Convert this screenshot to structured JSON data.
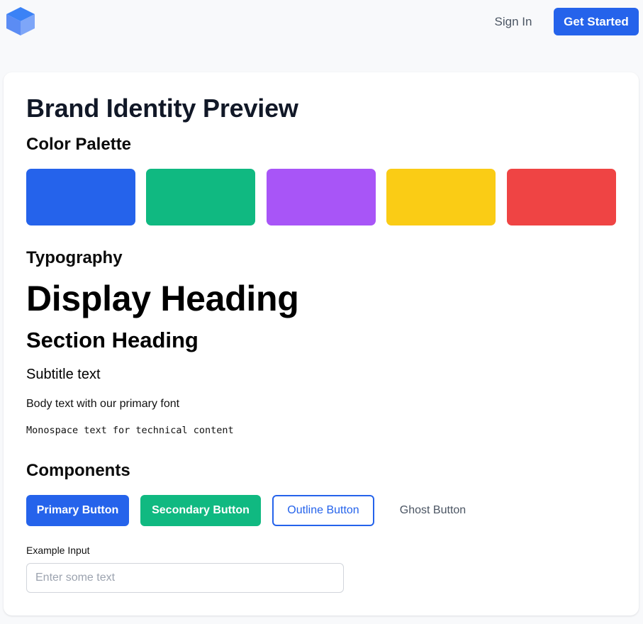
{
  "header": {
    "logo_icon": "cube-logo-icon",
    "sign_in_label": "Sign In",
    "get_started_label": "Get Started"
  },
  "main": {
    "title": "Brand Identity Preview",
    "color_palette": {
      "heading": "Color Palette",
      "swatches": [
        "#2563eb",
        "#10b981",
        "#a855f7",
        "#facc15",
        "#ef4444"
      ]
    },
    "typography": {
      "heading": "Typography",
      "display": "Display Heading",
      "section": "Section Heading",
      "subtitle": "Subtitle text",
      "body": "Body text with our primary font",
      "mono": "Monospace text for technical content"
    },
    "components": {
      "heading": "Components",
      "buttons": {
        "primary": "Primary Button",
        "secondary": "Secondary Button",
        "outline": "Outline Button",
        "ghost": "Ghost Button"
      },
      "input": {
        "label": "Example Input",
        "placeholder": "Enter some text",
        "value": ""
      }
    }
  },
  "colors": {
    "accent": "#2563eb",
    "success": "#10b981"
  }
}
